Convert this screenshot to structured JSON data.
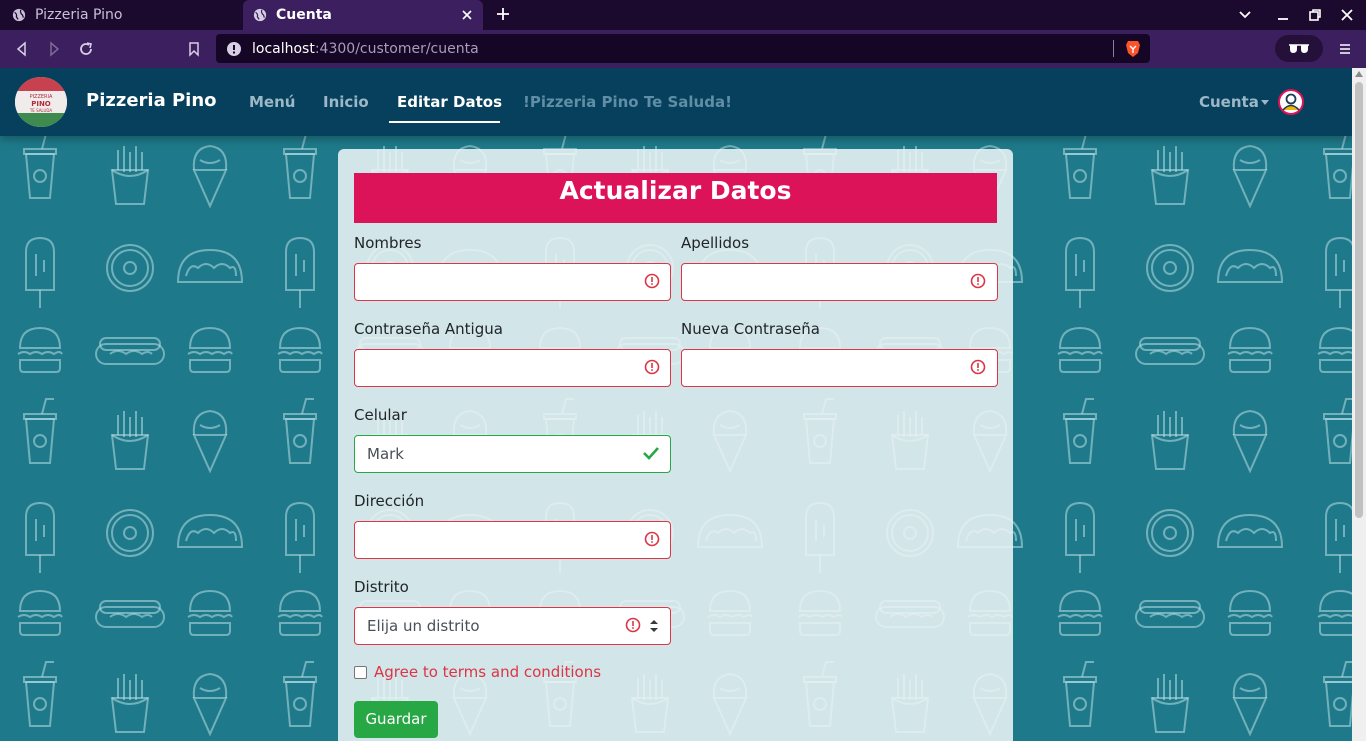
{
  "browser": {
    "tabs": [
      {
        "label": "Pizzeria Pino",
        "active": false
      },
      {
        "label": "Cuenta",
        "active": true
      }
    ],
    "url_host": "localhost",
    "url_rest": ":4300/customer/cuenta"
  },
  "navbar": {
    "brand": "Pizzeria Pino",
    "logo_text": [
      "PIZZERIA",
      "PINO",
      "TE SALUDA"
    ],
    "links": [
      "Menú",
      "Inicio",
      "Editar Datos",
      "!Pizzeria Pino Te Saluda!"
    ],
    "account": "Cuenta"
  },
  "form": {
    "title": "Actualizar Datos",
    "fields": {
      "nombres": {
        "label": "Nombres",
        "value": ""
      },
      "apellidos": {
        "label": "Apellidos",
        "value": ""
      },
      "old_password": {
        "label": "Contraseña Antigua",
        "value": ""
      },
      "new_password": {
        "label": "Nueva Contraseña",
        "value": ""
      },
      "celular": {
        "label": "Celular",
        "value": "Mark"
      },
      "direccion": {
        "label": "Dirección",
        "value": ""
      },
      "distrito": {
        "label": "Distrito",
        "value": "Elija un distrito"
      }
    },
    "terms_label": "Agree to terms and conditions",
    "submit_label": "Guardar"
  },
  "colors": {
    "accent": "#dc1359",
    "invalid": "#dc3545",
    "valid": "#28a745",
    "navbar": "#07405c",
    "page_bg": "#1e7a8a"
  }
}
